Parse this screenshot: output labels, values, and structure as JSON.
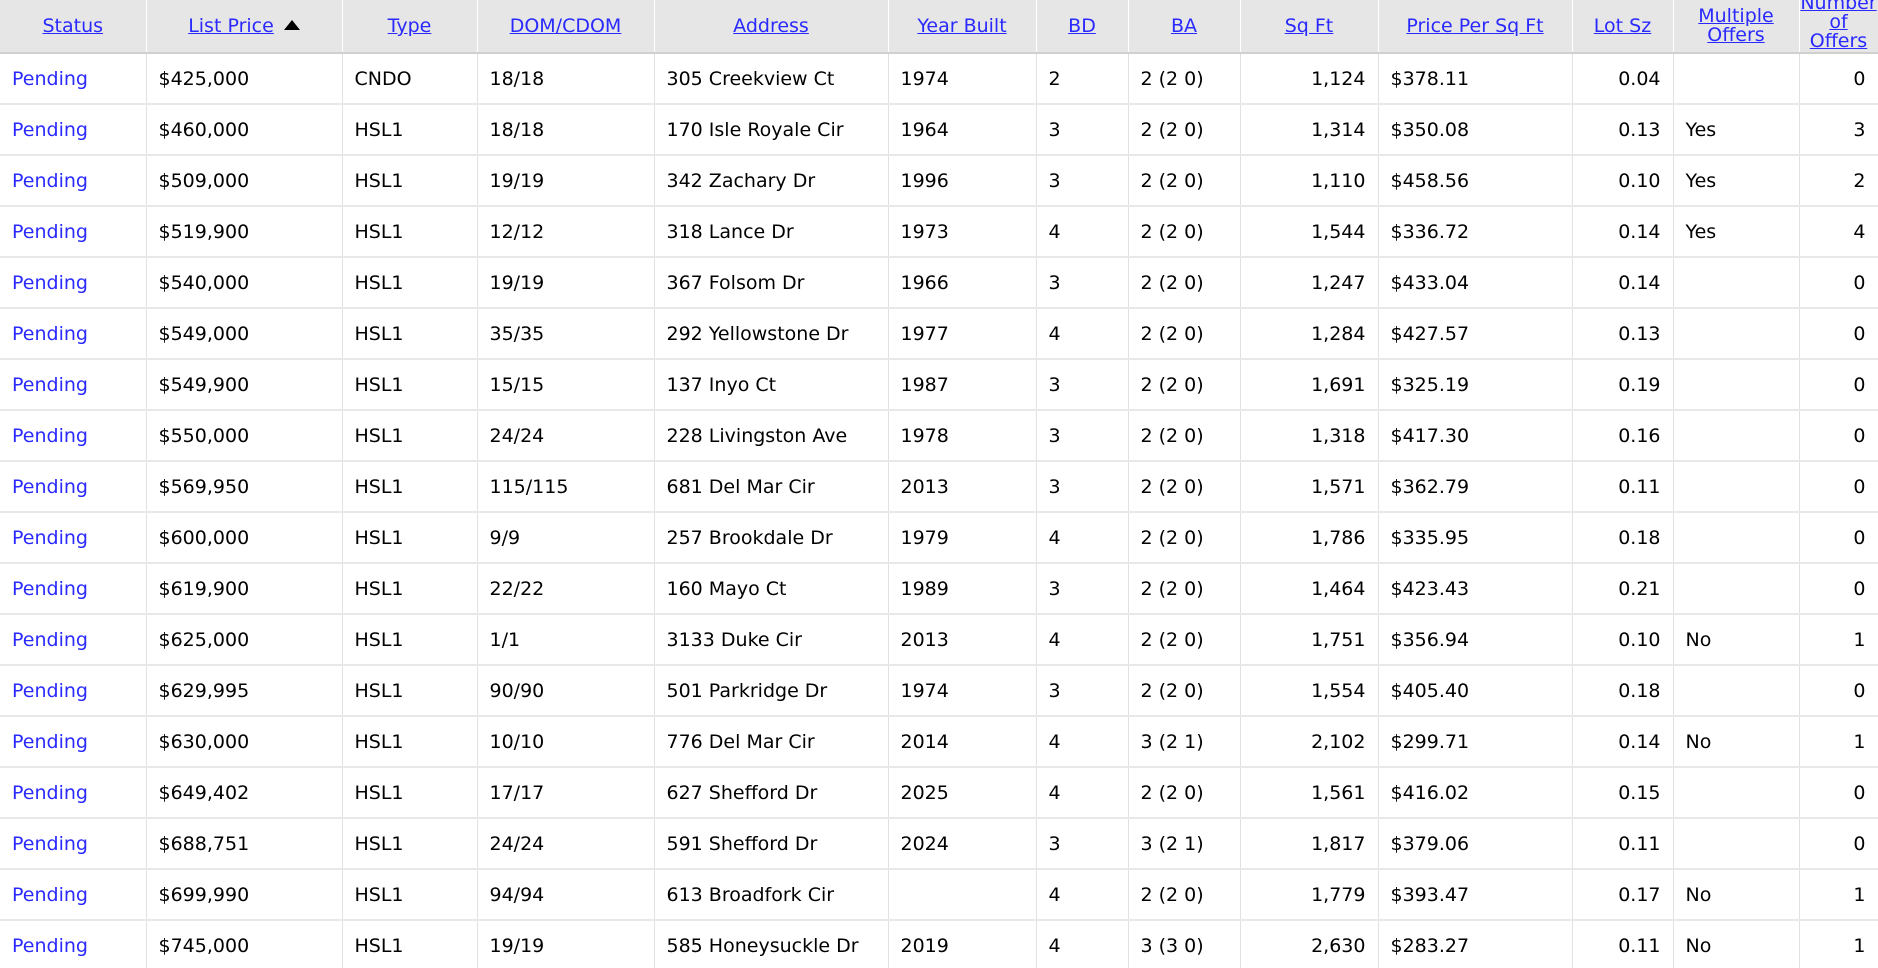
{
  "table": {
    "headers": {
      "status": "Status",
      "list_price": "List Price",
      "type": "Type",
      "dom_cdom": "DOM/CDOM",
      "address": "Address",
      "year_built": "Year Built",
      "bd": "BD",
      "ba": "BA",
      "sq_ft": "Sq Ft",
      "price_per_sq_ft": "Price Per Sq Ft",
      "lot_sz": "Lot Sz",
      "multiple_offers": "Multiple Offers",
      "number_of_offers": "Number of Offers"
    },
    "sort": {
      "column": "List Price",
      "direction": "ascending"
    },
    "rows": [
      {
        "status": "Pending",
        "list_price": "$425,000",
        "type": "CNDO",
        "dom_cdom": "18/18",
        "address": "305 Creekview Ct",
        "year_built": "1974",
        "bd": "2",
        "ba": "2 (2 0)",
        "sq_ft": "1,124",
        "price_per_sq_ft": "$378.11",
        "lot_sz": "0.04",
        "multiple_offers": "",
        "number_of_offers": "0"
      },
      {
        "status": "Pending",
        "list_price": "$460,000",
        "type": "HSL1",
        "dom_cdom": "18/18",
        "address": "170 Isle Royale Cir",
        "year_built": "1964",
        "bd": "3",
        "ba": "2 (2 0)",
        "sq_ft": "1,314",
        "price_per_sq_ft": "$350.08",
        "lot_sz": "0.13",
        "multiple_offers": "Yes",
        "number_of_offers": "3"
      },
      {
        "status": "Pending",
        "list_price": "$509,000",
        "type": "HSL1",
        "dom_cdom": "19/19",
        "address": "342 Zachary Dr",
        "year_built": "1996",
        "bd": "3",
        "ba": "2 (2 0)",
        "sq_ft": "1,110",
        "price_per_sq_ft": "$458.56",
        "lot_sz": "0.10",
        "multiple_offers": "Yes",
        "number_of_offers": "2"
      },
      {
        "status": "Pending",
        "list_price": "$519,900",
        "type": "HSL1",
        "dom_cdom": "12/12",
        "address": "318 Lance Dr",
        "year_built": "1973",
        "bd": "4",
        "ba": "2 (2 0)",
        "sq_ft": "1,544",
        "price_per_sq_ft": "$336.72",
        "lot_sz": "0.14",
        "multiple_offers": "Yes",
        "number_of_offers": "4"
      },
      {
        "status": "Pending",
        "list_price": "$540,000",
        "type": "HSL1",
        "dom_cdom": "19/19",
        "address": "367 Folsom Dr",
        "year_built": "1966",
        "bd": "3",
        "ba": "2 (2 0)",
        "sq_ft": "1,247",
        "price_per_sq_ft": "$433.04",
        "lot_sz": "0.14",
        "multiple_offers": "",
        "number_of_offers": "0"
      },
      {
        "status": "Pending",
        "list_price": "$549,000",
        "type": "HSL1",
        "dom_cdom": "35/35",
        "address": "292 Yellowstone Dr",
        "year_built": "1977",
        "bd": "4",
        "ba": "2 (2 0)",
        "sq_ft": "1,284",
        "price_per_sq_ft": "$427.57",
        "lot_sz": "0.13",
        "multiple_offers": "",
        "number_of_offers": "0"
      },
      {
        "status": "Pending",
        "list_price": "$549,900",
        "type": "HSL1",
        "dom_cdom": "15/15",
        "address": "137 Inyo Ct",
        "year_built": "1987",
        "bd": "3",
        "ba": "2 (2 0)",
        "sq_ft": "1,691",
        "price_per_sq_ft": "$325.19",
        "lot_sz": "0.19",
        "multiple_offers": "",
        "number_of_offers": "0"
      },
      {
        "status": "Pending",
        "list_price": "$550,000",
        "type": "HSL1",
        "dom_cdom": "24/24",
        "address": "228 Livingston Ave",
        "year_built": "1978",
        "bd": "3",
        "ba": "2 (2 0)",
        "sq_ft": "1,318",
        "price_per_sq_ft": "$417.30",
        "lot_sz": "0.16",
        "multiple_offers": "",
        "number_of_offers": "0"
      },
      {
        "status": "Pending",
        "list_price": "$569,950",
        "type": "HSL1",
        "dom_cdom": "115/115",
        "address": "681 Del Mar Cir",
        "year_built": "2013",
        "bd": "3",
        "ba": "2 (2 0)",
        "sq_ft": "1,571",
        "price_per_sq_ft": "$362.79",
        "lot_sz": "0.11",
        "multiple_offers": "",
        "number_of_offers": "0"
      },
      {
        "status": "Pending",
        "list_price": "$600,000",
        "type": "HSL1",
        "dom_cdom": "9/9",
        "address": "257 Brookdale Dr",
        "year_built": "1979",
        "bd": "4",
        "ba": "2 (2 0)",
        "sq_ft": "1,786",
        "price_per_sq_ft": "$335.95",
        "lot_sz": "0.18",
        "multiple_offers": "",
        "number_of_offers": "0"
      },
      {
        "status": "Pending",
        "list_price": "$619,900",
        "type": "HSL1",
        "dom_cdom": "22/22",
        "address": "160 Mayo Ct",
        "year_built": "1989",
        "bd": "3",
        "ba": "2 (2 0)",
        "sq_ft": "1,464",
        "price_per_sq_ft": "$423.43",
        "lot_sz": "0.21",
        "multiple_offers": "",
        "number_of_offers": "0"
      },
      {
        "status": "Pending",
        "list_price": "$625,000",
        "type": "HSL1",
        "dom_cdom": "1/1",
        "address": "3133 Duke Cir",
        "year_built": "2013",
        "bd": "4",
        "ba": "2 (2 0)",
        "sq_ft": "1,751",
        "price_per_sq_ft": "$356.94",
        "lot_sz": "0.10",
        "multiple_offers": "No",
        "number_of_offers": "1"
      },
      {
        "status": "Pending",
        "list_price": "$629,995",
        "type": "HSL1",
        "dom_cdom": "90/90",
        "address": "501 Parkridge Dr",
        "year_built": "1974",
        "bd": "3",
        "ba": "2 (2 0)",
        "sq_ft": "1,554",
        "price_per_sq_ft": "$405.40",
        "lot_sz": "0.18",
        "multiple_offers": "",
        "number_of_offers": "0"
      },
      {
        "status": "Pending",
        "list_price": "$630,000",
        "type": "HSL1",
        "dom_cdom": "10/10",
        "address": "776 Del Mar Cir",
        "year_built": "2014",
        "bd": "4",
        "ba": "3 (2 1)",
        "sq_ft": "2,102",
        "price_per_sq_ft": "$299.71",
        "lot_sz": "0.14",
        "multiple_offers": "No",
        "number_of_offers": "1"
      },
      {
        "status": "Pending",
        "list_price": "$649,402",
        "type": "HSL1",
        "dom_cdom": "17/17",
        "address": "627 Shefford Dr",
        "year_built": "2025",
        "bd": "4",
        "ba": "2 (2 0)",
        "sq_ft": "1,561",
        "price_per_sq_ft": "$416.02",
        "lot_sz": "0.15",
        "multiple_offers": "",
        "number_of_offers": "0"
      },
      {
        "status": "Pending",
        "list_price": "$688,751",
        "type": "HSL1",
        "dom_cdom": "24/24",
        "address": "591 Shefford Dr",
        "year_built": "2024",
        "bd": "3",
        "ba": "3 (2 1)",
        "sq_ft": "1,817",
        "price_per_sq_ft": "$379.06",
        "lot_sz": "0.11",
        "multiple_offers": "",
        "number_of_offers": "0"
      },
      {
        "status": "Pending",
        "list_price": "$699,990",
        "type": "HSL1",
        "dom_cdom": "94/94",
        "address": "613 Broadfork Cir",
        "year_built": "",
        "bd": "4",
        "ba": "2 (2 0)",
        "sq_ft": "1,779",
        "price_per_sq_ft": "$393.47",
        "lot_sz": "0.17",
        "multiple_offers": "No",
        "number_of_offers": "1"
      },
      {
        "status": "Pending",
        "list_price": "$745,000",
        "type": "HSL1",
        "dom_cdom": "19/19",
        "address": "585 Honeysuckle Dr",
        "year_built": "2019",
        "bd": "4",
        "ba": "3 (3 0)",
        "sq_ft": "2,630",
        "price_per_sq_ft": "$283.27",
        "lot_sz": "0.11",
        "multiple_offers": "No",
        "number_of_offers": "1"
      }
    ]
  },
  "colors": {
    "link": "#2a2aff",
    "header_bg": "#e6e6e6"
  },
  "icons": {
    "sort": "sort-ascending-icon"
  }
}
